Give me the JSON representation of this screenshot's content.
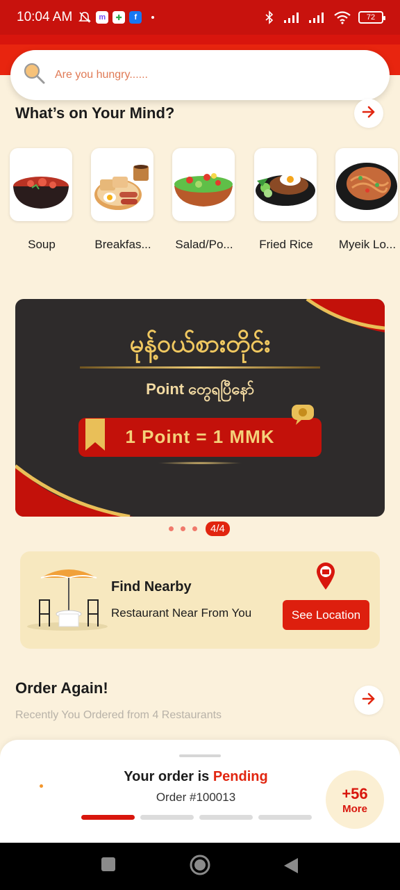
{
  "status_bar": {
    "time": "10:04 AM",
    "battery": "72",
    "icons": [
      "notifications-muted-icon",
      "messenger-icon",
      "photos-icon",
      "facebook-icon",
      "dot-icon",
      "bluetooth-icon",
      "signal-icon",
      "signal-icon",
      "wifi-icon",
      "battery-icon"
    ]
  },
  "search": {
    "placeholder": "Are you hungry......"
  },
  "categories": {
    "title": "What’s on Your Mind?",
    "items": [
      {
        "label": "Soup"
      },
      {
        "label": "Breakfas..."
      },
      {
        "label": "Salad/Po..."
      },
      {
        "label": "Fried Rice"
      },
      {
        "label": "Myeik Lo..."
      }
    ]
  },
  "banner": {
    "title": "မုန့်ဝယ်စားတိုင်း",
    "subtitle": "Point တွေရပြီနော်",
    "pill_text": "1 Point  =  1 MMK"
  },
  "carousel": {
    "page": "4/4"
  },
  "nearby": {
    "title": "Find Nearby",
    "subtitle": "Restaurant Near From You",
    "button": "See Location"
  },
  "order_again": {
    "title": "Order Again!",
    "subtitle": "Recently You Ordered from 4 Restaurants"
  },
  "order_sheet": {
    "status_prefix": "Your order is ",
    "status": "Pending",
    "order_number": "Order #100013",
    "progress_active_steps": 1,
    "progress_total_steps": 4,
    "more_count": "+56",
    "more_label": "More"
  },
  "colors": {
    "primary": "#e1250f",
    "background": "#fbf1dc",
    "banner_dark": "#2e2b2b",
    "gold": "#f0c860"
  }
}
